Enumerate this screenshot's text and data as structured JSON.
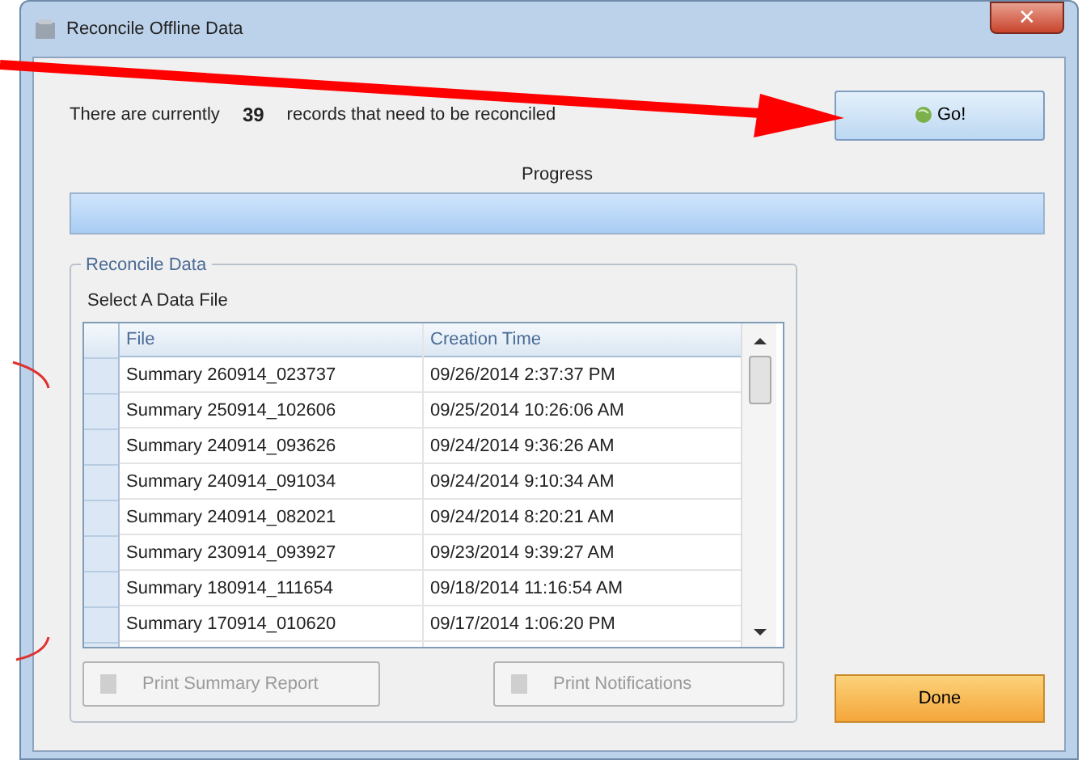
{
  "window": {
    "title": "Reconcile Offline Data",
    "close": "✕"
  },
  "status": {
    "before": "There are currently",
    "count": "39",
    "after": "records that need to be reconciled"
  },
  "go_button": {
    "label": "Go!"
  },
  "progress": {
    "label": "Progress",
    "level": 1
  },
  "group": {
    "title": "Reconcile Data",
    "prompt": "Select A Data File"
  },
  "table": {
    "columns": [
      "File",
      "Creation Time"
    ],
    "rows": [
      {
        "file": "Summary 260914_023737",
        "time": "09/26/2014 2:37:37 PM"
      },
      {
        "file": "Summary 250914_102606",
        "time": "09/25/2014 10:26:06 AM"
      },
      {
        "file": "Summary 240914_093626",
        "time": "09/24/2014 9:36:26 AM"
      },
      {
        "file": "Summary 240914_091034",
        "time": "09/24/2014 9:10:34 AM"
      },
      {
        "file": "Summary 240914_082021",
        "time": "09/24/2014 8:20:21 AM"
      },
      {
        "file": "Summary 230914_093927",
        "time": "09/23/2014 9:39:27 AM"
      },
      {
        "file": "Summary 180914_111654",
        "time": "09/18/2014 11:16:54 AM"
      },
      {
        "file": "Summary 170914_010620",
        "time": "09/17/2014 1:06:20 PM"
      }
    ]
  },
  "buttons": [
    {
      "label": "Print Summary Report",
      "disabled": true
    },
    {
      "label": "Print Notifications",
      "disabled": true
    }
  ],
  "done_button": {
    "label": "Done"
  }
}
